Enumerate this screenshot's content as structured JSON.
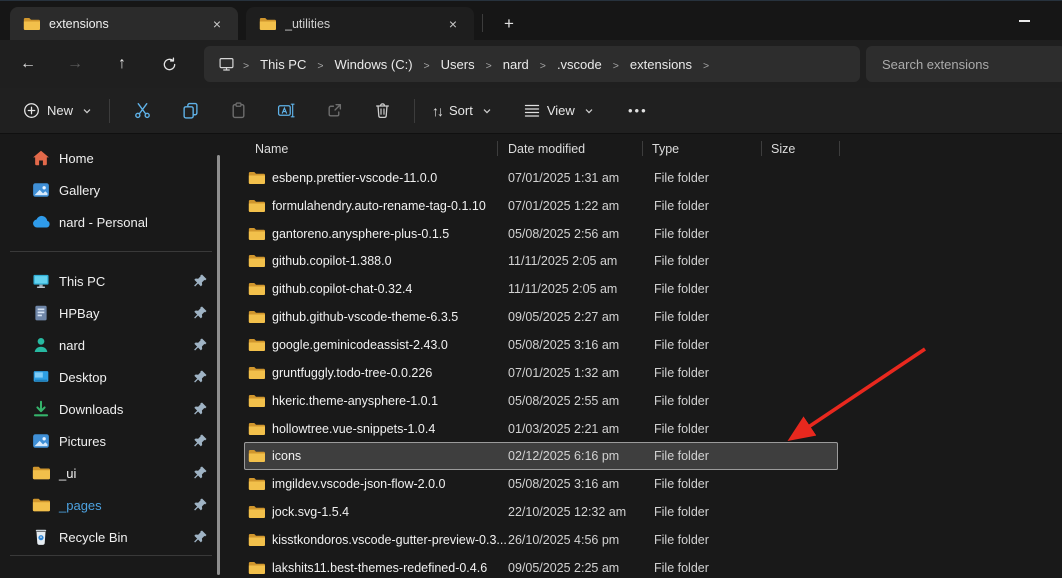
{
  "tabs": [
    {
      "label": "extensions",
      "active": true
    },
    {
      "label": "_utilities",
      "active": false
    }
  ],
  "icons": {
    "close": "×",
    "new_tab": "+",
    "back": "←",
    "forward": "→",
    "up": "↑",
    "breadcrumb_separator": ">",
    "sort_glyph": "↑↓",
    "more_glyph": "•••",
    "expander_chevron": "❭"
  },
  "navigation": {
    "breadcrumb": [
      "This PC",
      "Windows (C:)",
      "Users",
      "nard",
      ".vscode",
      "extensions"
    ],
    "search_placeholder": "Search extensions"
  },
  "toolbar": {
    "new_label": "New",
    "sort_label": "Sort",
    "view_label": "View"
  },
  "columns": {
    "name": "Name",
    "date": "Date modified",
    "type": "Type",
    "size": "Size"
  },
  "sidebar": {
    "items": [
      {
        "label": "Home"
      },
      {
        "label": "Gallery"
      },
      {
        "label": "nard - Personal"
      },
      {
        "label": "This PC",
        "pinned": true
      },
      {
        "label": "HPBay",
        "pinned": true
      },
      {
        "label": "nard",
        "pinned": true
      },
      {
        "label": "Desktop",
        "pinned": true
      },
      {
        "label": "Downloads",
        "pinned": true
      },
      {
        "label": "Pictures",
        "pinned": true
      },
      {
        "label": "_ui",
        "pinned": true
      },
      {
        "label": "_pages",
        "pinned": true
      },
      {
        "label": "Recycle Bin",
        "pinned": true
      }
    ]
  },
  "files": {
    "rows": [
      {
        "name": "esbenp.prettier-vscode-11.0.0",
        "date": "07/01/2025 1:31 am",
        "type": "File folder",
        "size": ""
      },
      {
        "name": "formulahendry.auto-rename-tag-0.1.10",
        "date": "07/01/2025 1:22 am",
        "type": "File folder",
        "size": ""
      },
      {
        "name": "gantoreno.anysphere-plus-0.1.5",
        "date": "05/08/2025 2:56 am",
        "type": "File folder",
        "size": ""
      },
      {
        "name": "github.copilot-1.388.0",
        "date": "11/11/2025 2:05 am",
        "type": "File folder",
        "size": ""
      },
      {
        "name": "github.copilot-chat-0.32.4",
        "date": "11/11/2025 2:05 am",
        "type": "File folder",
        "size": ""
      },
      {
        "name": "github.github-vscode-theme-6.3.5",
        "date": "09/05/2025 2:27 am",
        "type": "File folder",
        "size": ""
      },
      {
        "name": "google.geminicodeassist-2.43.0",
        "date": "05/08/2025 3:16 am",
        "type": "File folder",
        "size": ""
      },
      {
        "name": "gruntfuggly.todo-tree-0.0.226",
        "date": "07/01/2025 1:32 am",
        "type": "File folder",
        "size": ""
      },
      {
        "name": "hkeric.theme-anysphere-1.0.1",
        "date": "05/08/2025 2:55 am",
        "type": "File folder",
        "size": ""
      },
      {
        "name": "hollowtree.vue-snippets-1.0.4",
        "date": "01/03/2025 2:21 am",
        "type": "File folder",
        "size": ""
      },
      {
        "name": "icons",
        "date": "02/12/2025 6:16 pm",
        "type": "File folder",
        "size": "",
        "selected": true
      },
      {
        "name": "imgildev.vscode-json-flow-2.0.0",
        "date": "05/08/2025 3:16 am",
        "type": "File folder",
        "size": ""
      },
      {
        "name": "jock.svg-1.5.4",
        "date": "22/10/2025 12:32 am",
        "type": "File folder",
        "size": ""
      },
      {
        "name": "kisstkondoros.vscode-gutter-preview-0.3...",
        "date": "26/10/2025 4:56 pm",
        "type": "File folder",
        "size": ""
      },
      {
        "name": "lakshits11.best-themes-redefined-0.4.6",
        "date": "09/05/2025 2:25 am",
        "type": "File folder",
        "size": ""
      }
    ]
  },
  "colors": {
    "selection_bg": "#3e3e3e",
    "selection_border": "#9b9b9b",
    "folder_yellow": "#f2c04b",
    "accent_blue": "#5fb2e8",
    "annotation_arrow": "#e8281e"
  }
}
